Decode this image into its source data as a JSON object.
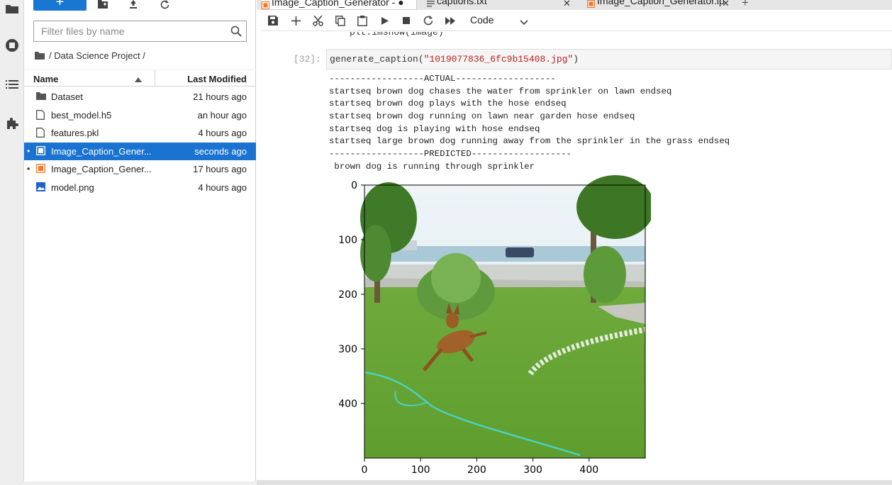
{
  "activity_bar": {
    "icons": [
      "folder-icon",
      "running-icon",
      "toc-icon",
      "extension-icon"
    ]
  },
  "file_browser": {
    "new_button_label": "+",
    "filter_placeholder": "Filter files by name",
    "breadcrumb": "/ Data Science Project /",
    "columns": {
      "name": "Name",
      "modified": "Last Modified"
    },
    "files": [
      {
        "name": "Dataset",
        "modified": "21 hours ago",
        "icon": "folder-icon",
        "running": false,
        "selected": false
      },
      {
        "name": "best_model.h5",
        "modified": "an hour ago",
        "icon": "file-icon",
        "running": false,
        "selected": false
      },
      {
        "name": "features.pkl",
        "modified": "4 hours ago",
        "icon": "file-icon",
        "running": false,
        "selected": false
      },
      {
        "name": "Image_Caption_Gener...",
        "modified": "seconds ago",
        "icon": "notebook-icon",
        "running": true,
        "selected": true
      },
      {
        "name": "Image_Caption_Gener...",
        "modified": "17 hours ago",
        "icon": "notebook-icon",
        "running": true,
        "selected": false
      },
      {
        "name": "model.png",
        "modified": "4 hours ago",
        "icon": "image-icon",
        "running": false,
        "selected": false
      }
    ]
  },
  "tabs": [
    {
      "label": "Image_Caption_Generator - ●",
      "active": true
    },
    {
      "label": "captions.txt",
      "active": false
    },
    {
      "label": "Image_Caption_Generator.ip",
      "active": false
    }
  ],
  "toolbar": {
    "cell_type": "Code"
  },
  "notebook": {
    "prev_code": "plt.imshow(image)",
    "prompt": "[32]:",
    "input_func": "generate_caption(",
    "input_arg": "\"1019077836_6fc9b15408.jpg\"",
    "input_close": ")",
    "output_lines": [
      "------------------ACTUAL-------------------",
      "startseq brown dog chases the water from sprinkler on lawn endseq",
      "startseq brown dog plays with the hose endseq",
      "startseq brown dog running on lawn near garden hose endseq",
      "startseq dog is playing with hose endseq",
      "startseq large brown dog running away from the sprinkler in the grass endseq",
      "------------------PREDICTED-------------------",
      " brown dog is running through sprinkler"
    ]
  },
  "chart_data": {
    "type": "image",
    "x_ticks": [
      "0",
      "100",
      "200",
      "300",
      "400"
    ],
    "y_ticks": [
      "0",
      "100",
      "200",
      "300",
      "400"
    ],
    "xlim": [
      0,
      500
    ],
    "ylim": [
      500,
      0
    ]
  },
  "colors": {
    "accent": "#1976d2",
    "selected_row": "#1a73d0",
    "notebook_orange": "#f37726",
    "string": "#ba2121"
  }
}
